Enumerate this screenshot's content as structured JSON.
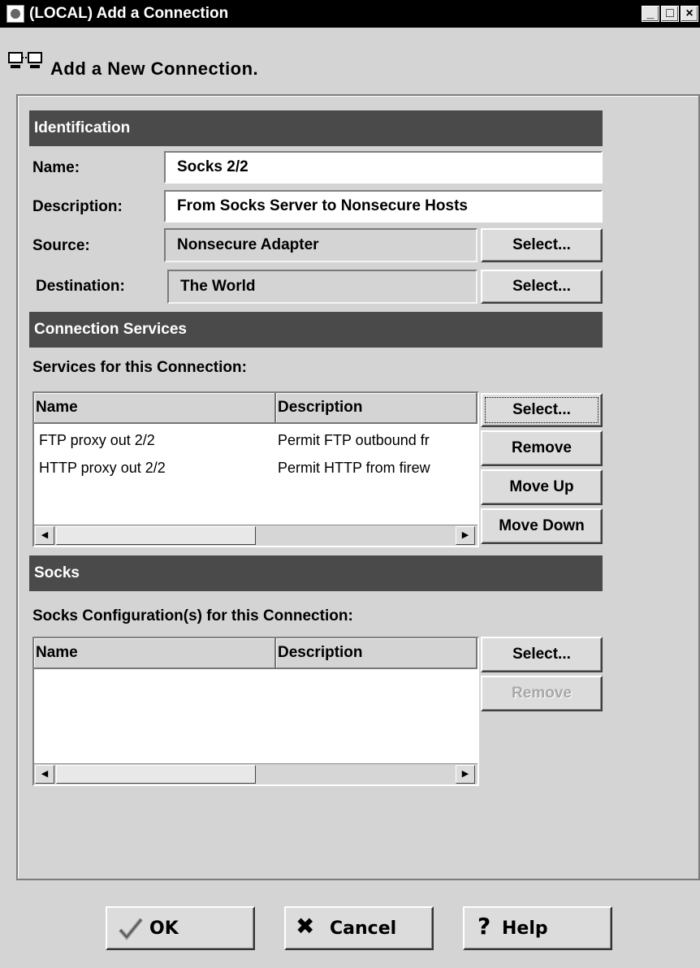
{
  "window": {
    "title": "(LOCAL) Add a Connection",
    "minimize": "_",
    "maximize": "□",
    "close": "×"
  },
  "heading": "Add a New Connection.",
  "identification": {
    "header": "Identification",
    "name_label": "Name:",
    "name_value": "Socks 2/2",
    "description_label": "Description:",
    "description_value": "From Socks Server to Nonsecure Hosts",
    "source_label": "Source:",
    "source_value": "Nonsecure Adapter",
    "source_select": "Select...",
    "destination_label": "Destination:",
    "destination_value": "The World",
    "destination_select": "Select..."
  },
  "services": {
    "header": "Connection Services",
    "list_label": "Services for this Connection:",
    "columns": [
      "Name",
      "Description"
    ],
    "rows": [
      {
        "name": "FTP proxy out 2/2",
        "description": "Permit FTP outbound fr"
      },
      {
        "name": "HTTP proxy out 2/2",
        "description": "Permit HTTP from firew"
      }
    ],
    "buttons": {
      "select": "Select...",
      "remove": "Remove",
      "move_up": "Move Up",
      "move_down": "Move Down"
    }
  },
  "socks": {
    "header": "Socks",
    "list_label": "Socks Configuration(s) for this Connection:",
    "columns": [
      "Name",
      "Description"
    ],
    "buttons": {
      "select": "Select...",
      "remove": "Remove"
    }
  },
  "footer": {
    "ok": "OK",
    "cancel": "Cancel",
    "help": "Help",
    "ok_icon": "checkmark-icon",
    "cancel_icon": "x-icon",
    "help_icon": "question-icon"
  }
}
